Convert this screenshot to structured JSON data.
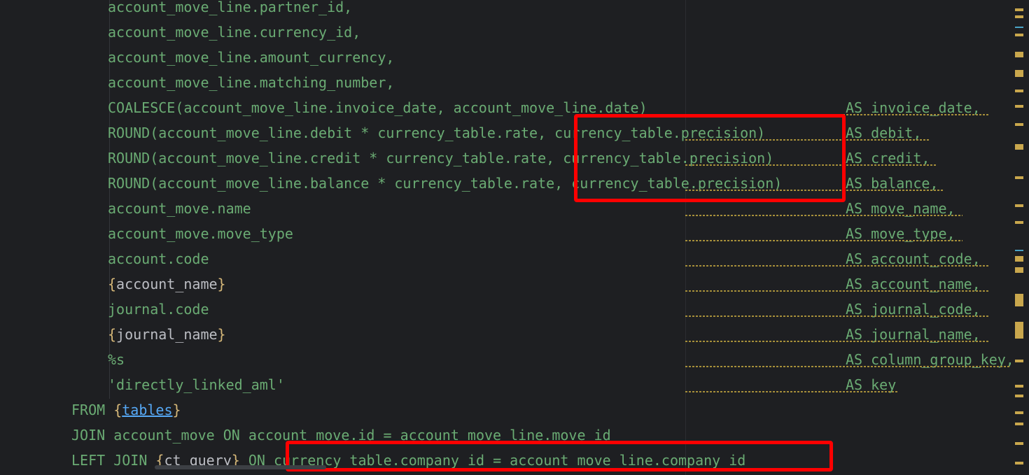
{
  "editor": {
    "lines": [
      {
        "code": "account_move_line.partner_id,",
        "alias": ""
      },
      {
        "code": "account_move_line.currency_id,",
        "alias": ""
      },
      {
        "code": "account_move_line.amount_currency,",
        "alias": ""
      },
      {
        "code": "account_move_line.matching_number,",
        "alias": ""
      },
      {
        "code": "COALESCE(account_move_line.invoice_date, account_move_line.date)",
        "alias": "AS invoice_date,"
      },
      {
        "code": "ROUND(account_move_line.debit * currency_table.rate, currency_table.precision)",
        "alias": "AS debit,"
      },
      {
        "code": "ROUND(account_move_line.credit * currency_table.rate, currency_table.precision)",
        "alias": "AS credit,"
      },
      {
        "code": "ROUND(account_move_line.balance * currency_table.rate, currency_table.precision)",
        "alias": "AS balance,"
      },
      {
        "code": "account_move.name",
        "alias": "AS move_name,"
      },
      {
        "code": "account_move.move_type",
        "alias": "AS move_type,"
      },
      {
        "code": "account.code",
        "alias": "AS account_code,"
      },
      {
        "code_pre": "{",
        "code_mid": "account_name",
        "code_post": "}",
        "alias": "AS account_name,"
      },
      {
        "code": "journal.code",
        "alias": "AS journal_code,"
      },
      {
        "code_pre": "{",
        "code_mid": "journal_name",
        "code_post": "}",
        "alias": "AS journal_name,"
      },
      {
        "code": "%s",
        "alias": "AS column_group_key,"
      },
      {
        "code": "'directly_linked_aml'",
        "alias": "AS key"
      }
    ],
    "from_keyword": "FROM",
    "from_brace_open": "{",
    "from_placeholder": "tables",
    "from_brace_close": "}",
    "join_line": "JOIN account_move ON account_move.id = account_move_line.move_id",
    "left_join_keyword": "LEFT JOIN",
    "left_join_brace_open": "{",
    "left_join_placeholder": "ct_query",
    "left_join_brace_close": "}",
    "left_join_on": "ON",
    "left_join_condition": "currency_table.company_id = account_move_line.company_id"
  },
  "colors": {
    "background": "#1e1f22",
    "sql_text": "#6aab73",
    "keyword": "#cf8e6d",
    "highlight_box": "#ff0000"
  }
}
